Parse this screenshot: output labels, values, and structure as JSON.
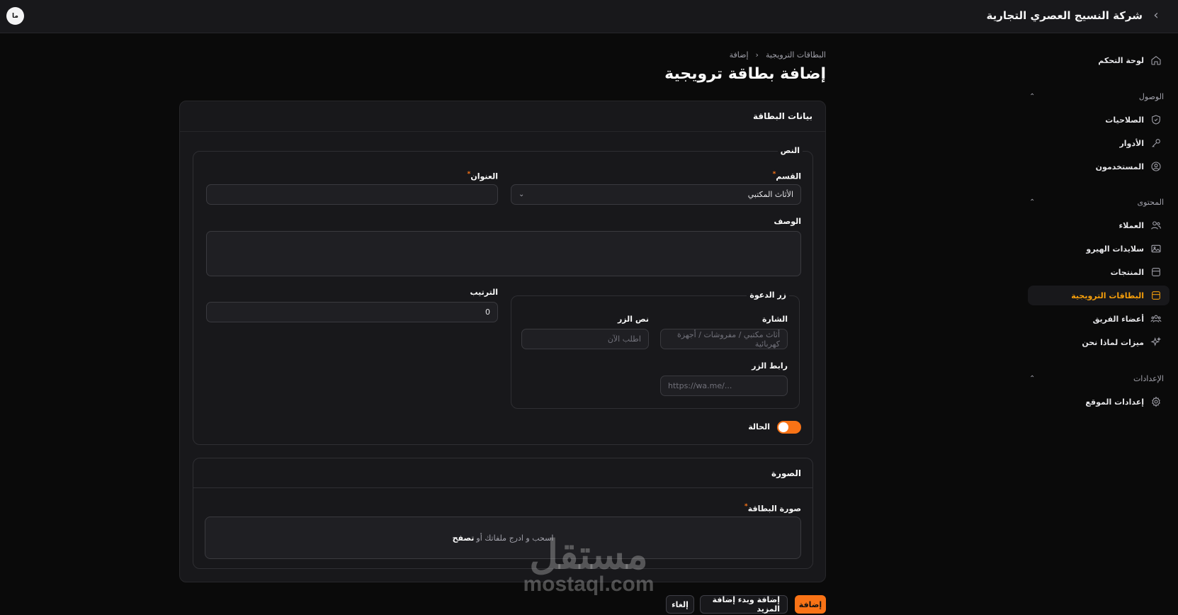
{
  "header": {
    "company_name": "شركة النسيج العصري التجارية",
    "avatar_initials": "ما"
  },
  "sidebar": {
    "dashboard": "لوحة التحكم",
    "groups": {
      "access": "الوصول",
      "content": "المحتوى",
      "settings": "الإعدادات"
    },
    "items": {
      "permissions": "الصلاحيات",
      "roles": "الأدوار",
      "users": "المستخدمون",
      "clients": "العملاء",
      "hero_slides": "سلايدات الهيرو",
      "products": "المنتجات",
      "promo_cards": "البطاقات الترويجية",
      "team_members": "أعضاء الفريق",
      "why_us": "ميزات لماذا نحن",
      "site_settings": "إعدادات الموقع"
    },
    "active_item": "promo_cards",
    "accent_color": "#f59e0b"
  },
  "breadcrumb": {
    "parent": "البطاقات الترويجية",
    "current": "إضافة"
  },
  "page": {
    "title": "إضافة بطاقة ترويجية"
  },
  "form": {
    "section_title": "بيانات البطاقة",
    "text_group": {
      "legend": "النص",
      "category_label": "القسم",
      "category_value": "الأثاث المكتبي",
      "title_label": "العنوان",
      "title_value": "",
      "description_label": "الوصف",
      "order_label": "الترتيب",
      "order_value": "0",
      "cta_group": {
        "legend": "زر الدعوة",
        "badge_label": "الشارة",
        "badge_placeholder": "أثاث مكتبي / مفروشات / أجهزة كهربائية",
        "button_text_label": "نص الزر",
        "button_text_placeholder": "اطلب الآن",
        "button_link_label": "رابط الزر",
        "button_link_placeholder": "https://wa.me/..."
      },
      "status_label": "الحالة",
      "status_on": true
    },
    "image_group": {
      "title": "الصورة",
      "card_image_label": "صورة البطاقة",
      "dropzone_text": "اسحب و ادرج ملفاتك أو",
      "dropzone_browse": "تصفح"
    }
  },
  "actions": {
    "create": "إضافة",
    "create_another": "إضافة وبدء إضافة المزيد",
    "cancel": "إلغاء"
  },
  "watermark": {
    "arabic": "مستقل",
    "latin": "mostaql.com"
  }
}
